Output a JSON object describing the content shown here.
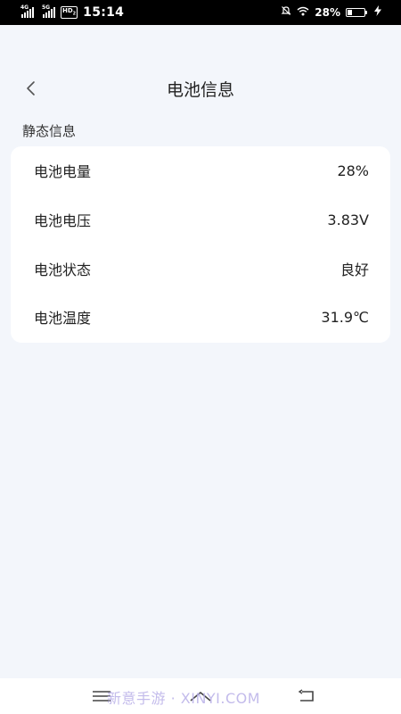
{
  "status_bar": {
    "network_1": "4G",
    "network_2": "5G",
    "hd_badge": "HD",
    "hd_sub": "2",
    "time": "15:14",
    "battery_percent": "28%",
    "battery_level": 0.28,
    "icons": [
      "signal-icon",
      "signal-icon",
      "hd-icon",
      "mute-icon",
      "wifi-icon",
      "battery-icon",
      "charging-icon"
    ]
  },
  "header": {
    "title": "电池信息",
    "back_icon": "chevron-left-icon"
  },
  "section": {
    "label": "静态信息"
  },
  "battery_info": {
    "rows": [
      {
        "label": "电池电量",
        "value": "28%"
      },
      {
        "label": "电池电压",
        "value": "3.83V"
      },
      {
        "label": "电池状态",
        "value": "良好"
      },
      {
        "label": "电池温度",
        "value": "31.9℃"
      }
    ]
  },
  "nav_bar": {
    "icons": [
      "menu-icon",
      "home-icon",
      "back-icon"
    ],
    "watermark": "新意手游 · XINYI.COM"
  },
  "colors": {
    "background": "#f3f6fb",
    "card": "#ffffff",
    "status_bar": "#000000",
    "watermark": "#b9b0e8"
  }
}
